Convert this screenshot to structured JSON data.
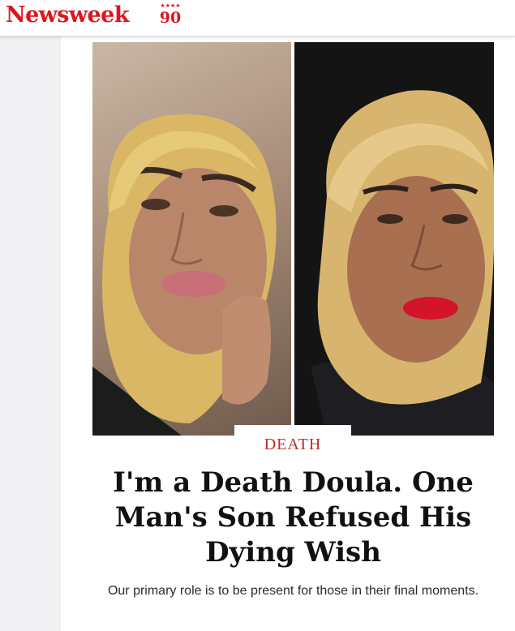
{
  "header": {
    "logo_text": "Newsweek",
    "anniversary_stars": "★★★★",
    "anniversary_number": "90",
    "brand_color": "#e0141e"
  },
  "article": {
    "section": "DEATH",
    "headline": "I'm a Death Doula. One Man's Son Refused His Dying Wish",
    "dek": "Our primary role is to be present for those in their final moments.",
    "section_color": "#c22a2a"
  },
  "images": [
    {
      "name": "portrait-left",
      "description": "woman with blonde hair, pink lips, light background"
    },
    {
      "name": "portrait-right",
      "description": "woman with blonde hair, red lips, black background"
    }
  ]
}
